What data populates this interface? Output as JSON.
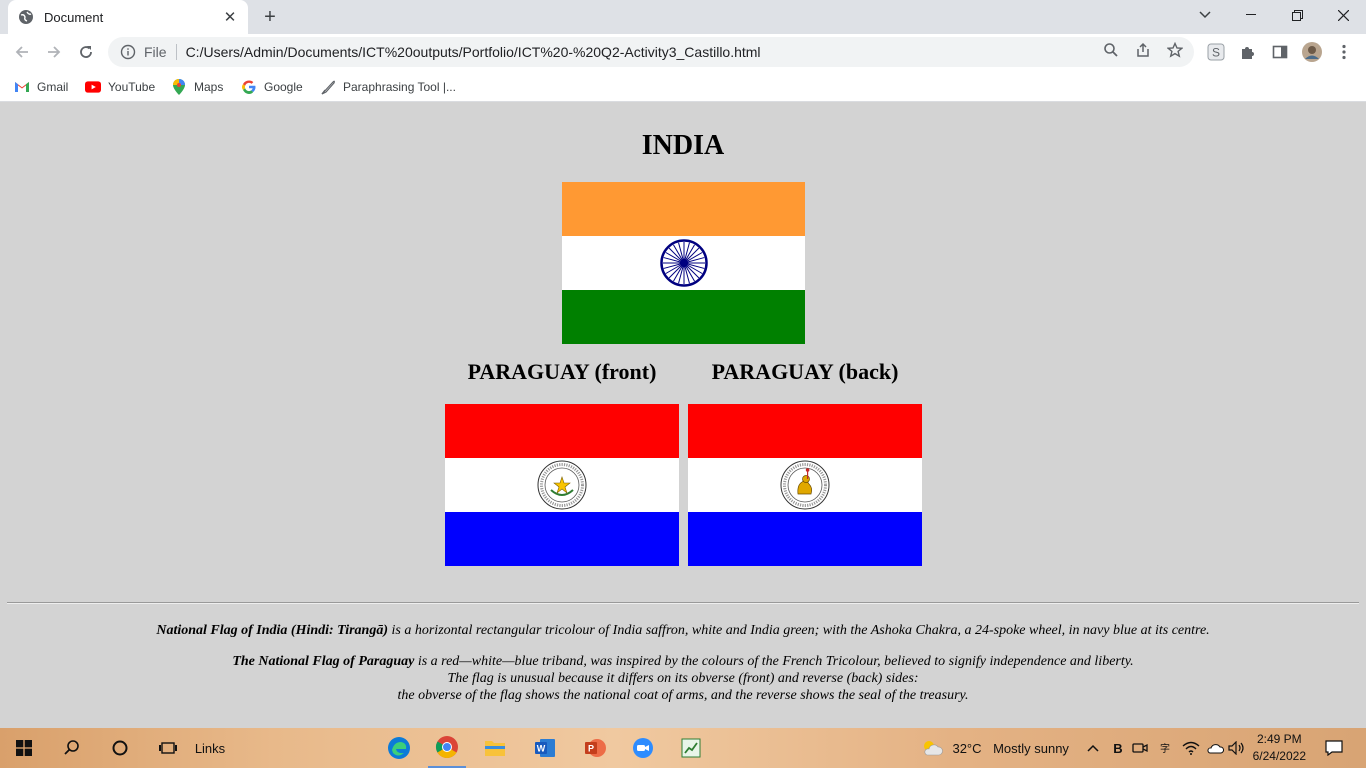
{
  "browser": {
    "tab_title": "Document",
    "tab_close": "✕",
    "new_tab": "+",
    "file_label": "File",
    "url": "C:/Users/Admin/Documents/ICT%20outputs/Portfolio/ICT%20-%20Q2-Activity3_Castillo.html",
    "bookmarks": [
      {
        "label": "Gmail",
        "icon": "gmail-icon"
      },
      {
        "label": "YouTube",
        "icon": "youtube-icon"
      },
      {
        "label": "Maps",
        "icon": "maps-icon"
      },
      {
        "label": "Google",
        "icon": "google-icon"
      },
      {
        "label": "Paraphrasing Tool |...",
        "icon": "feather-icon"
      }
    ]
  },
  "page": {
    "india_heading": "INDIA",
    "paraguay_front_heading": "PARAGUAY (front)",
    "paraguay_back_heading": "PARAGUAY (back)",
    "india_desc_bold": "National Flag of India (Hindi: Tirangā)",
    "india_desc_text": " is a horizontal rectangular tricolour of India saffron, white and India green; with the Ashoka Chakra, a 24-spoke wheel, in navy blue at its centre.",
    "paraguay_desc_bold": "The National Flag of Paraguay",
    "paraguay_desc_text": " is a red—white—blue triband, was inspired by the colours of the French Tricolour, believed to signify independence and liberty.",
    "paraguay_desc_line2": "The flag is unusual because it differs on its obverse (front) and reverse (back) sides:",
    "paraguay_desc_line3": "the obverse of the flag shows the national coat of arms, and the reverse shows the seal of the treasury.",
    "colors": {
      "india_saffron": "#ff9933",
      "india_white": "#ffffff",
      "india_green": "#008000",
      "chakra_navy": "#000080",
      "paraguay_red": "#ff0000",
      "paraguay_white": "#ffffff",
      "paraguay_blue": "#0000ff"
    }
  },
  "taskbar": {
    "links_label": "Links",
    "weather": "32°C",
    "weather_desc": "Mostly sunny",
    "time": "2:49 PM",
    "date": "6/24/2022"
  }
}
